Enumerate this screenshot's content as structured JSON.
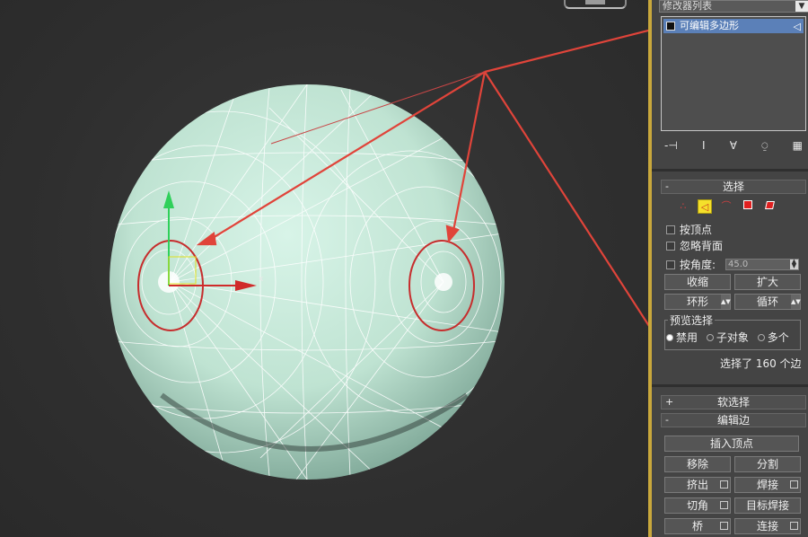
{
  "panel": {
    "modifier_list": "修改器列表",
    "stack_item": "可编辑多边形",
    "stack_tools": [
      "-⊣",
      "I",
      "∀",
      "⍜",
      "▦"
    ],
    "selection": {
      "header": "选择",
      "collapse": "-",
      "by_vertex": "按顶点",
      "ignore_backfacing": "忽略背面",
      "by_angle": "按角度:",
      "angle_value": "45.0",
      "shrink": "收缩",
      "grow": "扩大",
      "ring": "环形",
      "loop": "循环",
      "preview_title": "预览选择",
      "preview_off": "禁用",
      "preview_subobj": "子对象",
      "preview_multi": "多个",
      "selected_text": "选择了 160 个边"
    },
    "soft_selection": {
      "header": "软选择",
      "expand": "+"
    },
    "edit_edges": {
      "header": "编辑边",
      "collapse": "-",
      "insert_vertex": "插入顶点",
      "remove": "移除",
      "split": "分割",
      "extrude": "挤出",
      "weld": "焊接",
      "chamfer": "切角",
      "target_weld": "目标焊接",
      "bridge": "桥",
      "connect": "连接"
    }
  },
  "viewport": {
    "axis_x": "x"
  },
  "colors": {
    "accent_border": "#c9a83c",
    "highlight_blue": "#5b80b8",
    "arrow_red": "#e0443a",
    "sphere": "#c8eadc"
  }
}
